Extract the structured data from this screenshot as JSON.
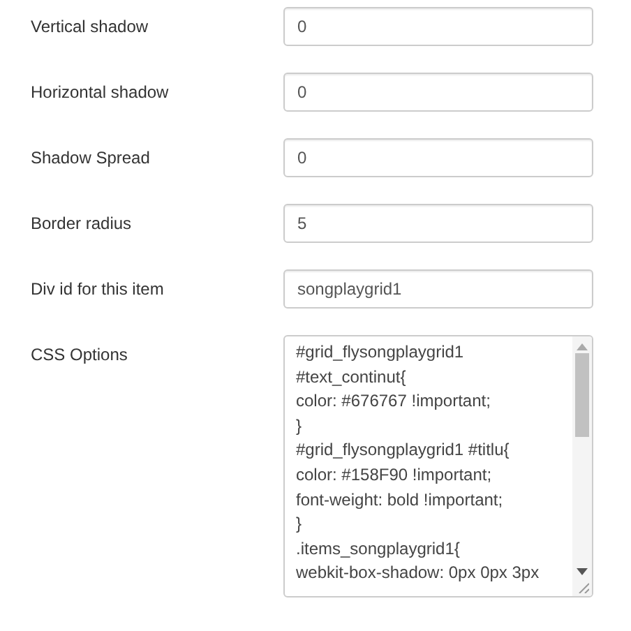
{
  "fields": [
    {
      "label": "Vertical shadow",
      "value": "0"
    },
    {
      "label": "Horizontal shadow",
      "value": "0"
    },
    {
      "label": "Shadow Spread",
      "value": "0"
    },
    {
      "label": "Border radius",
      "value": "5"
    },
    {
      "label": "Div id for this item",
      "value": "songplaygrid1"
    }
  ],
  "css_options": {
    "label": "CSS Options",
    "lines": [
      "#grid_flysongplaygrid1",
      "#text_continut{",
      "color: #676767 !important;",
      "}",
      "#grid_flysongplaygrid1 #titlu{",
      "color: #158F90 !important;",
      "font-weight: bold !important;",
      "}",
      ".items_songplaygrid1{",
      "webkit-box-shadow: 0px 0px 3px"
    ]
  }
}
